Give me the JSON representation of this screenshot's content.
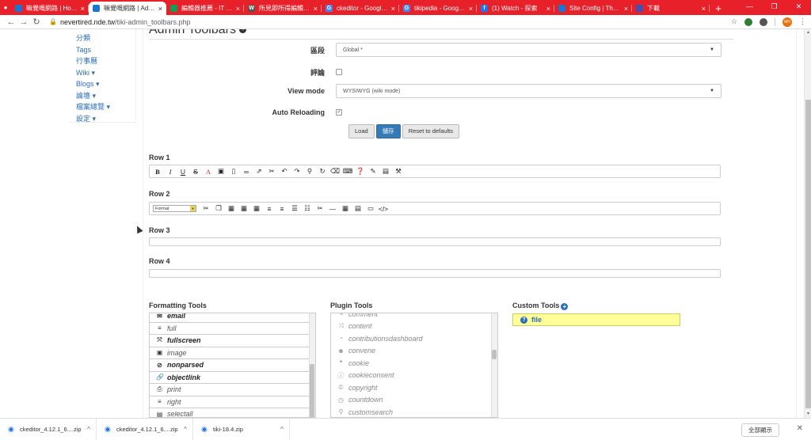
{
  "browser": {
    "tabs": [
      {
        "title": "嘛覺嘅網路 | HomePage",
        "active": false,
        "fav_color": "#1976d2",
        "fav": ""
      },
      {
        "title": "嘛覺嘅網路 | Admin Toolbars",
        "active": true,
        "fav_color": "#1976d2",
        "fav": ""
      },
      {
        "title": "編輯器推薦 - IT 邦幫忙::一起...",
        "active": false,
        "fav_color": "#0f9d58",
        "fav": ""
      },
      {
        "title": "所見即所得編輯器 - 維基百科",
        "active": false,
        "fav_color": "#555555",
        "fav": "W"
      },
      {
        "title": "ckeditor - Google 搜尋",
        "active": false,
        "fav_color": "#4285f4",
        "fav": "G"
      },
      {
        "title": "tikipedia - Google 搜尋",
        "active": false,
        "fav_color": "#4285f4",
        "fav": "G"
      },
      {
        "title": "(1) Watch - 探索",
        "active": false,
        "fav_color": "#1877f2",
        "fav": "f"
      },
      {
        "title": "Site Config | Themes",
        "active": false,
        "fav_color": "#1976d2",
        "fav": ""
      },
      {
        "title": "下載",
        "active": false,
        "fav_color": "#3f51b5",
        "fav": ""
      }
    ],
    "new_tab": "+",
    "url_host": "nevertired.nde.tw",
    "url_path": "/tiki-admin_toolbars.php",
    "profile_initials": "MH"
  },
  "sidebar": {
    "items": [
      "分類",
      "Tags",
      "行事曆",
      "Wiki ▾",
      "Blogs ▾",
      "論壇 ▾",
      "檔案總覽 ▾",
      "設定 ▾"
    ]
  },
  "page": {
    "title": "Admin Toolbars",
    "section_label": "區段",
    "section_value": "Global *",
    "comments_label": "評論",
    "comments_checked": false,
    "view_mode_label": "View mode",
    "view_mode_value": "WYSIWYG (wiki mode)",
    "auto_reload_label": "Auto Reloading",
    "auto_reload_checked": true,
    "buttons": {
      "load": "Load",
      "save": "儲存",
      "reset": "Reset to defaults"
    },
    "rows": [
      "Row 1",
      "Row 2",
      "Row 3",
      "Row 4"
    ],
    "format_select": "Format"
  },
  "formatting_tools": {
    "label": "Formatting Tools",
    "items": [
      {
        "icon": "envelope-icon",
        "glyph": "✉",
        "label": "email",
        "bold": true
      },
      {
        "icon": "bars-icon",
        "glyph": "≡",
        "label": "full",
        "bold": false
      },
      {
        "icon": "expand-icon",
        "glyph": "⤧",
        "label": "fullscreen",
        "bold": true
      },
      {
        "icon": "image-icon",
        "glyph": "▣",
        "label": "image",
        "bold": false
      },
      {
        "icon": "ban-icon",
        "glyph": "⊘",
        "label": "nonparsed",
        "bold": true
      },
      {
        "icon": "link-icon",
        "glyph": "🔗",
        "label": "objectlink",
        "bold": true
      },
      {
        "icon": "print-icon",
        "glyph": "⎙",
        "label": "print",
        "bold": false
      },
      {
        "icon": "align-right-icon",
        "glyph": "≡",
        "label": "right",
        "bold": false
      },
      {
        "icon": "file-icon",
        "glyph": "▤",
        "label": "selectall",
        "bold": false
      }
    ]
  },
  "plugin_tools": {
    "label": "Plugin Tools",
    "items": [
      {
        "icon": "comment-icon",
        "glyph": "✎",
        "label": "comment"
      },
      {
        "icon": "random-icon",
        "glyph": "⤨",
        "label": "content"
      },
      {
        "icon": "dashboard-icon",
        "glyph": "◔",
        "label": "contributionsdashboard"
      },
      {
        "icon": "users-icon",
        "glyph": "☻",
        "label": "convene"
      },
      {
        "icon": "quote-icon",
        "glyph": "❝",
        "label": "cookie"
      },
      {
        "icon": "info-icon",
        "glyph": "ⓘ",
        "label": "cookieconsent"
      },
      {
        "icon": "copyright-icon",
        "glyph": "©",
        "label": "copyright"
      },
      {
        "icon": "clock-icon",
        "glyph": "◷",
        "label": "countdown"
      },
      {
        "icon": "search-icon",
        "glyph": "⚲",
        "label": "customsearch"
      }
    ]
  },
  "custom_tools": {
    "label": "Custom Tools",
    "items": [
      {
        "label": "file"
      }
    ]
  },
  "downloads": [
    {
      "name": "ckeditor_4.12.1_6....zip"
    },
    {
      "name": "ckeditor_4.12.1_6....zip"
    },
    {
      "name": "tiki-18.4.zip"
    }
  ],
  "downloads_show_all": "全部顯示"
}
